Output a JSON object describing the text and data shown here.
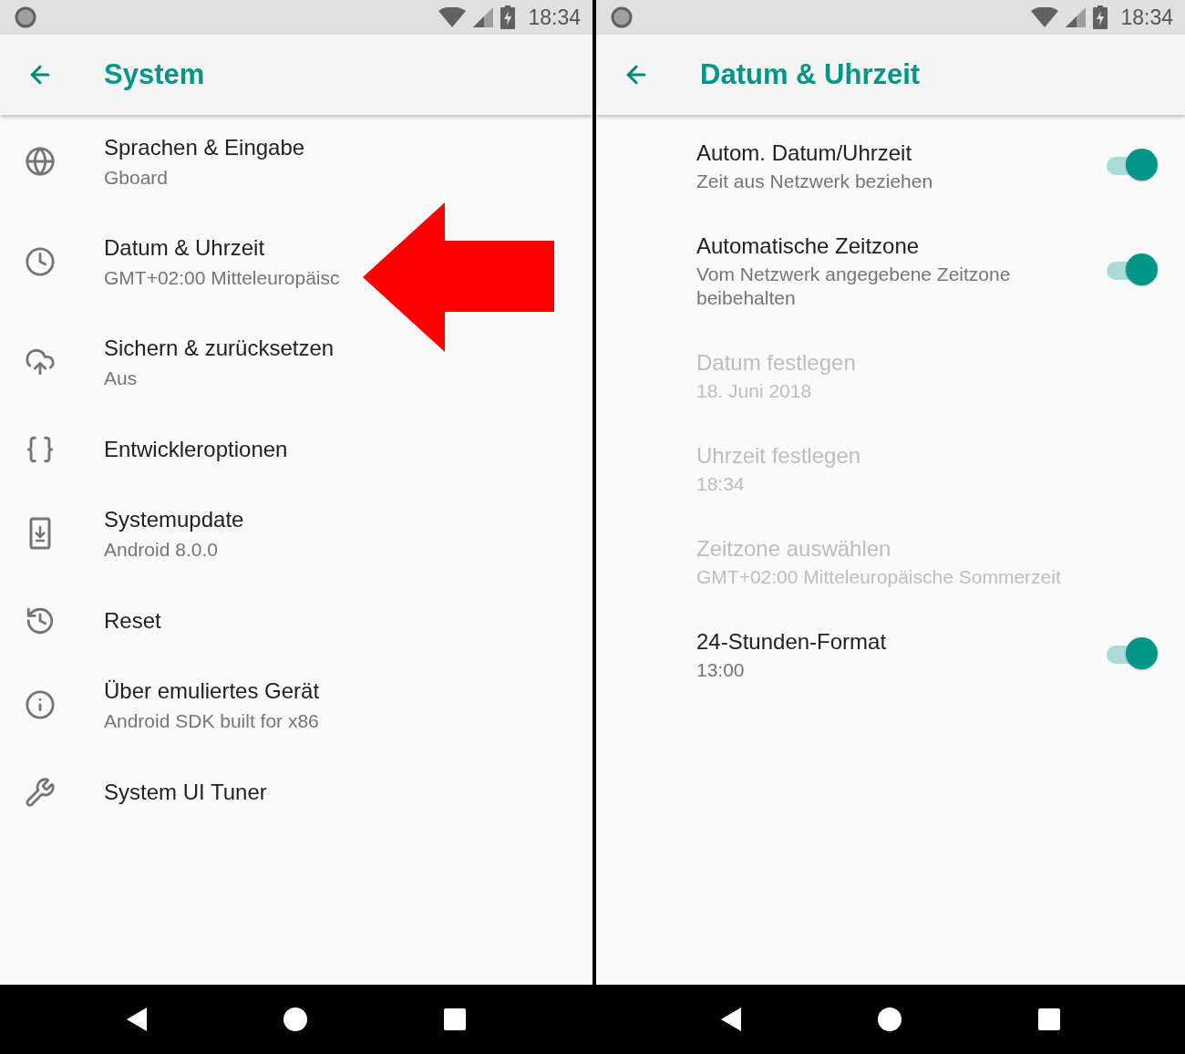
{
  "panels": [
    {
      "status_bar": {
        "time": "18:34"
      },
      "title": "System",
      "items": [
        {
          "title": "Sprachen & Eingabe",
          "summary": "Gboard"
        },
        {
          "title": "Datum & Uhrzeit",
          "summary": "GMT+02:00 Mitteleuropäisc"
        },
        {
          "title": "Sichern & zurücksetzen",
          "summary": "Aus"
        },
        {
          "title": "Entwickleroptionen"
        },
        {
          "title": "Systemupdate",
          "summary": "Android 8.0.0"
        },
        {
          "title": "Reset"
        },
        {
          "title": "Über emuliertes Gerät",
          "summary": "Android SDK built for x86"
        },
        {
          "title": "System UI Tuner"
        }
      ]
    },
    {
      "status_bar": {
        "time": "18:34"
      },
      "title": "Datum & Uhrzeit",
      "items": [
        {
          "kind": "switch",
          "title": "Autom. Datum/Uhrzeit",
          "summary": "Zeit aus Netzwerk beziehen",
          "disabled": false,
          "on": true
        },
        {
          "kind": "switch",
          "title": "Automatische Zeitzone",
          "summary": "Vom Netzwerk angegebene Zeitzone beibehalten",
          "disabled": false,
          "on": true
        },
        {
          "kind": "plain",
          "title": "Datum festlegen",
          "summary": "18. Juni 2018",
          "disabled": true
        },
        {
          "kind": "plain",
          "title": "Uhrzeit festlegen",
          "summary": "18:34",
          "disabled": true
        },
        {
          "kind": "plain",
          "title": "Zeitzone auswählen",
          "summary": "GMT+02:00 Mitteleuropäische Sommerzeit",
          "disabled": true
        },
        {
          "kind": "switch",
          "title": "24-Stunden-Format",
          "summary": "13:00",
          "disabled": false,
          "on": true
        }
      ]
    }
  ]
}
